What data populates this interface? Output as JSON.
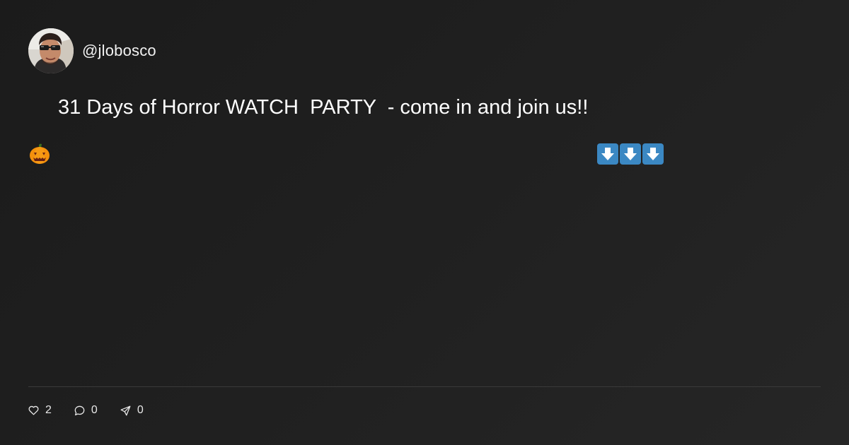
{
  "author": {
    "handle": "@jlobosco"
  },
  "post": {
    "leading_emoji": "pumpkin-emoji",
    "text": "31 Days of Horror WATCH  PARTY  - come in and join us!!",
    "trailing_emojis": [
      "down-arrow-emoji",
      "down-arrow-emoji",
      "down-arrow-emoji"
    ]
  },
  "stats": {
    "likes": "2",
    "comments": "0",
    "shares": "0"
  },
  "colors": {
    "background": "#1f1f1f",
    "text": "#ffffff",
    "divider": "#3a3a3a",
    "arrow_emoji": "#3b88c3"
  }
}
